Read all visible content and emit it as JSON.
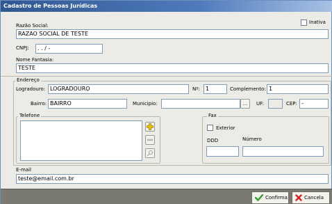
{
  "window": {
    "title": "Cadastro de Pessoas Jurídicas"
  },
  "inativa": {
    "label": "Inativa",
    "checked": false
  },
  "razao_social": {
    "label": "Razão Social:",
    "value": "RAZAO SOCIAL DE TESTE"
  },
  "cnpj": {
    "label": "CNPJ:",
    "value": " .  .  /  -"
  },
  "nome_fantasia": {
    "label": "Nome Fantasia:",
    "value": "TESTE"
  },
  "endereco": {
    "group_label": "Endereço",
    "logradouro_label": "Logradouro:",
    "logradouro_value": "LOGRADOURO",
    "numero_label": "Nº:",
    "numero_value": "1",
    "complemento_label": "Complemento:",
    "complemento_value": "1",
    "bairro_label": "Bairro:",
    "bairro_value": "BAIRRO",
    "municipio_label": "Municipio:",
    "municipio_value": "",
    "municipio_button": "...",
    "uf_label": "UF:",
    "uf_value": "",
    "cep_label": "CEP:",
    "cep_value": " -"
  },
  "telefone": {
    "group_label": "Telefone",
    "items": []
  },
  "fax": {
    "group_label": "Fax",
    "exterior_label": "Exterior",
    "exterior_checked": false,
    "ddd_label": "DDD",
    "ddd_value": "",
    "numero_label": "Número",
    "numero_value": ""
  },
  "email": {
    "label": "E-mail",
    "value": "teste@email.com.br"
  },
  "footer": {
    "confirm_label": "Confirma",
    "cancel_label": "Cancela"
  },
  "colors": {
    "title_bar": "#2f5791",
    "confirm_icon": "#2e9e2e",
    "cancel_icon": "#d42020",
    "add_icon": "#f2c200"
  }
}
